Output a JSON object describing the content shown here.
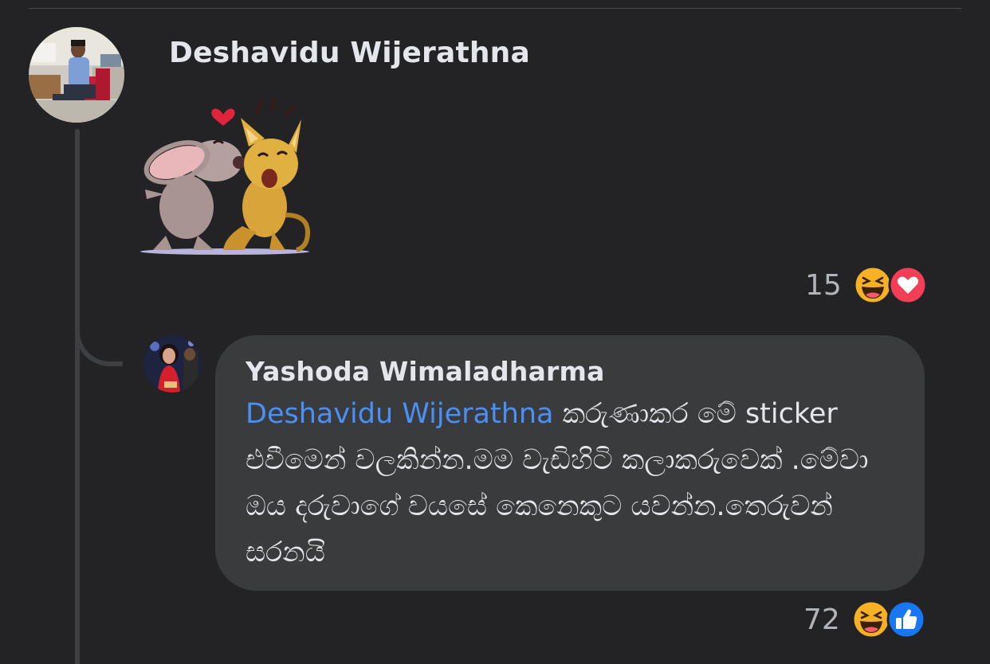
{
  "comment": {
    "author": "Deshavidu Wijerathna",
    "sticker_name": "mouse-kissing-cat-sticker",
    "reactions": {
      "count": "15",
      "icons": [
        "haha-icon",
        "love-icon"
      ]
    }
  },
  "reply": {
    "author": "Yashoda Wimaladharma",
    "mention": "Deshavidu Wijerathna",
    "text_line1": " කරුණාකර මේ sticker",
    "text_line2": "එවීමෙන් වලකින්න.මම වැඩිහිටි කලාකරුවෙක් .මේවා",
    "text_line3": "ඔය දරුවාගේ වයසේ කෙනෙකුට යවන්න.තෙරුවන්",
    "text_line4": "සරනයි",
    "reactions": {
      "count": "72",
      "icons": [
        "haha-icon",
        "like-icon"
      ]
    }
  },
  "colors": {
    "background": "#232325",
    "bubble": "#3a3b3d",
    "mention": "#4c8ff2",
    "text": "#e4e6eb",
    "muted": "#b0b3b8",
    "haha": "#f7b125",
    "love": "#f33e58",
    "like": "#1877f2"
  }
}
